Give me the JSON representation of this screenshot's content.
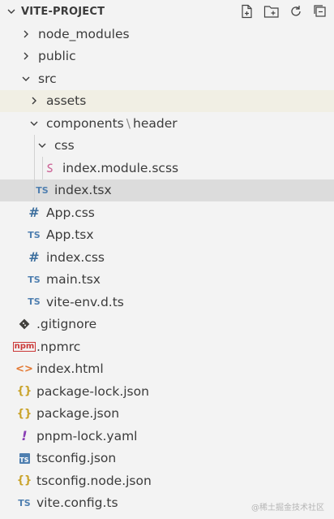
{
  "explorer": {
    "title": "VITE-PROJECT",
    "actions": [
      "new-file-icon",
      "new-folder-icon",
      "refresh-icon",
      "collapse-all-icon"
    ]
  },
  "tree": {
    "node_modules": "node_modules",
    "public": "public",
    "src": "src",
    "assets": "assets",
    "components": "components",
    "path_sep": "\\",
    "header": "header",
    "css": "css",
    "index_module_scss": "index.module.scss",
    "index_tsx": "index.tsx",
    "app_css": "App.css",
    "app_tsx": "App.tsx",
    "index_css": "index.css",
    "main_tsx": "main.tsx",
    "vite_env": "vite-env.d.ts",
    "gitignore": ".gitignore",
    "npmrc": ".npmrc",
    "index_html": "index.html",
    "package_lock": "package-lock.json",
    "package_json": "package.json",
    "pnpm_lock": "pnpm-lock.yaml",
    "tsconfig": "tsconfig.json",
    "tsconfig_node": "tsconfig.node.json",
    "vite_config": "vite.config.ts"
  },
  "badges": {
    "ts": "TS",
    "npm": "npm",
    "bang": "!",
    "braces": "{}",
    "angle": "<>",
    "hash": "#"
  },
  "watermark": "@稀土掘金技术社区",
  "colors": {
    "background": "#f3f3f3",
    "selected": "#dcdcdc",
    "selected_light": "#f1efe4",
    "ts_blue": "#4f7fb0",
    "json_yellow": "#c9a227",
    "html_orange": "#e37933",
    "npm_red": "#cb3837",
    "yaml_purple": "#8a3fb5",
    "git_dark": "#41403c",
    "scss_red": "#cd6799"
  }
}
